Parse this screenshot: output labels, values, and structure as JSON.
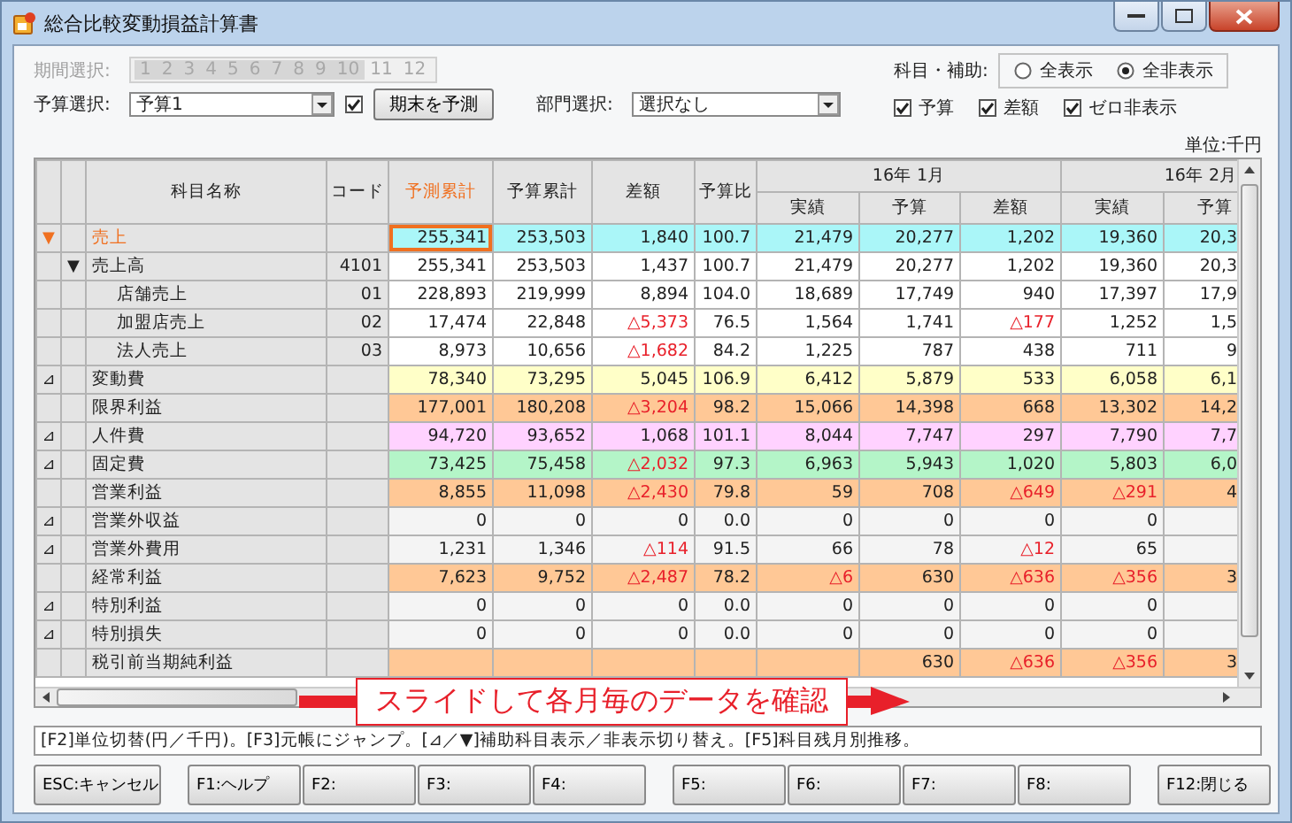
{
  "window": {
    "title": "総合比較変動損益計算書"
  },
  "period": {
    "label": "期間選択:",
    "disabled": true,
    "items": [
      {
        "label": "1",
        "selected": true
      },
      {
        "label": "2",
        "selected": true
      },
      {
        "label": "3",
        "selected": true
      },
      {
        "label": "4",
        "selected": true
      },
      {
        "label": "5",
        "selected": true
      },
      {
        "label": "6",
        "selected": true
      },
      {
        "label": "7",
        "selected": true
      },
      {
        "label": "8",
        "selected": true
      },
      {
        "label": "9",
        "selected": true
      },
      {
        "label": "10",
        "selected": true
      },
      {
        "label": "11",
        "selected": false
      },
      {
        "label": "12",
        "selected": false
      }
    ]
  },
  "budget": {
    "label": "予算選択:",
    "value": "予算1",
    "checked": true,
    "button": "期末を予測"
  },
  "department": {
    "label": "部門選択:",
    "value": "選択なし"
  },
  "subject": {
    "label": "科目・補助:",
    "options": [
      {
        "label": "全表示",
        "selected": false
      },
      {
        "label": "全非表示",
        "selected": true
      }
    ]
  },
  "toggles": [
    {
      "label": "予算",
      "checked": true
    },
    {
      "label": "差額",
      "checked": true
    },
    {
      "label": "ゼロ非表示",
      "checked": true
    }
  ],
  "unit": "単位:千円",
  "table": {
    "row_header_columns": [
      "科目名称",
      "コード"
    ],
    "columns": [
      {
        "label": "予測累計",
        "selected": true
      },
      {
        "label": "予算累計",
        "selected": false
      },
      {
        "label": "差額",
        "selected": false
      },
      {
        "label": "予算比",
        "selected": false
      }
    ],
    "months": [
      {
        "label": "16年 1月",
        "columns": [
          "実績",
          "予算",
          "差額"
        ]
      },
      {
        "label": "16年 2月",
        "columns": [
          "実績",
          "予算"
        ]
      }
    ],
    "rows": [
      {
        "marker": "▼",
        "name": "売上",
        "selected": true,
        "color": "#aaf6f8",
        "cells": [
          {
            "text": "255,341",
            "negative": false
          },
          {
            "text": "253,503",
            "negative": false
          },
          {
            "text": "1,840",
            "negative": false
          },
          {
            "text": "100.7",
            "negative": false
          },
          {
            "text": "21,479",
            "negative": false
          },
          {
            "text": "20,277",
            "negative": false
          },
          {
            "text": "1,202",
            "negative": false
          },
          {
            "text": "19,360",
            "negative": false
          },
          {
            "text": "20,3",
            "negative": false
          }
        ]
      },
      {
        "toggle": "▼",
        "name": "売上高",
        "code": "4101",
        "selected": false,
        "color": "#ffffff",
        "cells": [
          {
            "text": "255,341",
            "negative": false
          },
          {
            "text": "253,503",
            "negative": false
          },
          {
            "text": "1,437",
            "negative": false
          },
          {
            "text": "100.7",
            "negative": false
          },
          {
            "text": "21,479",
            "negative": false
          },
          {
            "text": "20,277",
            "negative": false
          },
          {
            "text": "1,202",
            "negative": false
          },
          {
            "text": "19,360",
            "negative": false
          },
          {
            "text": "20,3",
            "negative": false
          }
        ],
        "children": [
          {
            "name": "店舗売上",
            "code": "01",
            "selected": false,
            "color": "#ffffff",
            "cells": [
              {
                "text": "228,893",
                "negative": false
              },
              {
                "text": "219,999",
                "negative": false
              },
              {
                "text": "8,894",
                "negative": false
              },
              {
                "text": "104.0",
                "negative": false
              },
              {
                "text": "18,689",
                "negative": false
              },
              {
                "text": "17,749",
                "negative": false
              },
              {
                "text": "940",
                "negative": false
              },
              {
                "text": "17,397",
                "negative": false
              },
              {
                "text": "17,9",
                "negative": false
              }
            ]
          },
          {
            "name": "加盟店売上",
            "code": "02",
            "selected": false,
            "color": "#ffffff",
            "cells": [
              {
                "text": "17,474",
                "negative": false
              },
              {
                "text": "22,848",
                "negative": false
              },
              {
                "text": "△5,373",
                "negative": true
              },
              {
                "text": "76.5",
                "negative": false
              },
              {
                "text": "1,564",
                "negative": false
              },
              {
                "text": "1,741",
                "negative": false
              },
              {
                "text": "△177",
                "negative": true
              },
              {
                "text": "1,252",
                "negative": false
              },
              {
                "text": "1,5",
                "negative": false
              }
            ]
          },
          {
            "name": "法人売上",
            "code": "03",
            "selected": false,
            "color": "#ffffff",
            "cells": [
              {
                "text": "8,973",
                "negative": false
              },
              {
                "text": "10,656",
                "negative": false
              },
              {
                "text": "△1,682",
                "negative": true
              },
              {
                "text": "84.2",
                "negative": false
              },
              {
                "text": "1,225",
                "negative": false
              },
              {
                "text": "787",
                "negative": false
              },
              {
                "text": "438",
                "negative": false
              },
              {
                "text": "711",
                "negative": false
              },
              {
                "text": "9",
                "negative": false
              }
            ]
          }
        ]
      },
      {
        "marker": "⊿",
        "name": "変動費",
        "selected": false,
        "color": "#ffffc8",
        "cells": [
          {
            "text": "78,340",
            "negative": false
          },
          {
            "text": "73,295",
            "negative": false
          },
          {
            "text": "5,045",
            "negative": false
          },
          {
            "text": "106.9",
            "negative": false
          },
          {
            "text": "6,412",
            "negative": false
          },
          {
            "text": "5,879",
            "negative": false
          },
          {
            "text": "533",
            "negative": false
          },
          {
            "text": "6,058",
            "negative": false
          },
          {
            "text": "6,1",
            "negative": false
          }
        ]
      },
      {
        "name": "限界利益",
        "selected": false,
        "color": "#ffc896",
        "cells": [
          {
            "text": "177,001",
            "negative": false
          },
          {
            "text": "180,208",
            "negative": false
          },
          {
            "text": "△3,204",
            "negative": true
          },
          {
            "text": "98.2",
            "negative": false
          },
          {
            "text": "15,066",
            "negative": false
          },
          {
            "text": "14,398",
            "negative": false
          },
          {
            "text": "668",
            "negative": false
          },
          {
            "text": "13,302",
            "negative": false
          },
          {
            "text": "14,2",
            "negative": false
          }
        ]
      },
      {
        "marker": "⊿",
        "name": "人件費",
        "selected": false,
        "color": "#ffd2ff",
        "cells": [
          {
            "text": "94,720",
            "negative": false
          },
          {
            "text": "93,652",
            "negative": false
          },
          {
            "text": "1,068",
            "negative": false
          },
          {
            "text": "101.1",
            "negative": false
          },
          {
            "text": "8,044",
            "negative": false
          },
          {
            "text": "7,747",
            "negative": false
          },
          {
            "text": "297",
            "negative": false
          },
          {
            "text": "7,790",
            "negative": false
          },
          {
            "text": "7,7",
            "negative": false
          }
        ]
      },
      {
        "marker": "⊿",
        "name": "固定費",
        "selected": false,
        "color": "#b4f5c8",
        "cells": [
          {
            "text": "73,425",
            "negative": false
          },
          {
            "text": "75,458",
            "negative": false
          },
          {
            "text": "△2,032",
            "negative": true
          },
          {
            "text": "97.3",
            "negative": false
          },
          {
            "text": "6,963",
            "negative": false
          },
          {
            "text": "5,943",
            "negative": false
          },
          {
            "text": "1,020",
            "negative": false
          },
          {
            "text": "5,803",
            "negative": false
          },
          {
            "text": "6,0",
            "negative": false
          }
        ]
      },
      {
        "name": "営業利益",
        "selected": false,
        "color": "#ffc896",
        "cells": [
          {
            "text": "8,855",
            "negative": false
          },
          {
            "text": "11,098",
            "negative": false
          },
          {
            "text": "△2,430",
            "negative": true
          },
          {
            "text": "79.8",
            "negative": false
          },
          {
            "text": "59",
            "negative": false
          },
          {
            "text": "708",
            "negative": false
          },
          {
            "text": "△649",
            "negative": true
          },
          {
            "text": "△291",
            "negative": true
          },
          {
            "text": "4",
            "negative": false
          }
        ]
      },
      {
        "marker": "⊿",
        "name": "営業外収益",
        "selected": false,
        "color": "#f4f4f4",
        "cells": [
          {
            "text": "0",
            "negative": false
          },
          {
            "text": "0",
            "negative": false
          },
          {
            "text": "0",
            "negative": false
          },
          {
            "text": "0.0",
            "negative": false
          },
          {
            "text": "0",
            "negative": false
          },
          {
            "text": "0",
            "negative": false
          },
          {
            "text": "0",
            "negative": false
          },
          {
            "text": "0",
            "negative": false
          },
          null
        ]
      },
      {
        "marker": "⊿",
        "name": "営業外費用",
        "selected": false,
        "color": "#f4f4f4",
        "cells": [
          {
            "text": "1,231",
            "negative": false
          },
          {
            "text": "1,346",
            "negative": false
          },
          {
            "text": "△114",
            "negative": true
          },
          {
            "text": "91.5",
            "negative": false
          },
          {
            "text": "66",
            "negative": false
          },
          {
            "text": "78",
            "negative": false
          },
          {
            "text": "△12",
            "negative": true
          },
          {
            "text": "65",
            "negative": false
          },
          null
        ]
      },
      {
        "name": "経常利益",
        "selected": false,
        "color": "#ffc896",
        "cells": [
          {
            "text": "7,623",
            "negative": false
          },
          {
            "text": "9,752",
            "negative": false
          },
          {
            "text": "△2,487",
            "negative": true
          },
          {
            "text": "78.2",
            "negative": false
          },
          {
            "text": "△6",
            "negative": true
          },
          {
            "text": "630",
            "negative": false
          },
          {
            "text": "△636",
            "negative": true
          },
          {
            "text": "△356",
            "negative": true
          },
          {
            "text": "3",
            "negative": false
          }
        ]
      },
      {
        "marker": "⊿",
        "name": "特別利益",
        "selected": false,
        "color": "#f4f4f4",
        "cells": [
          {
            "text": "0",
            "negative": false
          },
          {
            "text": "0",
            "negative": false
          },
          {
            "text": "0",
            "negative": false
          },
          {
            "text": "0.0",
            "negative": false
          },
          {
            "text": "0",
            "negative": false
          },
          {
            "text": "0",
            "negative": false
          },
          {
            "text": "0",
            "negative": false
          },
          {
            "text": "0",
            "negative": false
          },
          null
        ]
      },
      {
        "marker": "⊿",
        "name": "特別損失",
        "selected": false,
        "color": "#f4f4f4",
        "cells": [
          {
            "text": "0",
            "negative": false
          },
          {
            "text": "0",
            "negative": false
          },
          {
            "text": "0",
            "negative": false
          },
          {
            "text": "0.0",
            "negative": false
          },
          {
            "text": "0",
            "negative": false
          },
          {
            "text": "0",
            "negative": false
          },
          {
            "text": "0",
            "negative": false
          },
          {
            "text": "0",
            "negative": false
          },
          null
        ]
      },
      {
        "name": "税引前当期純利益",
        "selected": false,
        "color": "#ffc896",
        "cells": [
          null,
          null,
          null,
          null,
          null,
          {
            "text": "630",
            "negative": false
          },
          {
            "text": "△636",
            "negative": true
          },
          {
            "text": "△356",
            "negative": true
          },
          {
            "text": "3",
            "negative": false
          }
        ]
      }
    ]
  },
  "callout": "スライドして各月毎のデータを確認",
  "hint": "[F2]単位切替(円／千円)。[F3]元帳にジャンプ。[⊿／▼]補助科目表示／非表示切り替え。[F5]科目残月別推移。",
  "button_groups": [
    [
      "ESC:キャンセル"
    ],
    [
      "F1:ヘルプ",
      "F2:",
      "F3:",
      "F4:"
    ],
    [
      "F5:",
      "F6:",
      "F7:",
      "F8:"
    ],
    [
      "F12:閉じる"
    ]
  ]
}
